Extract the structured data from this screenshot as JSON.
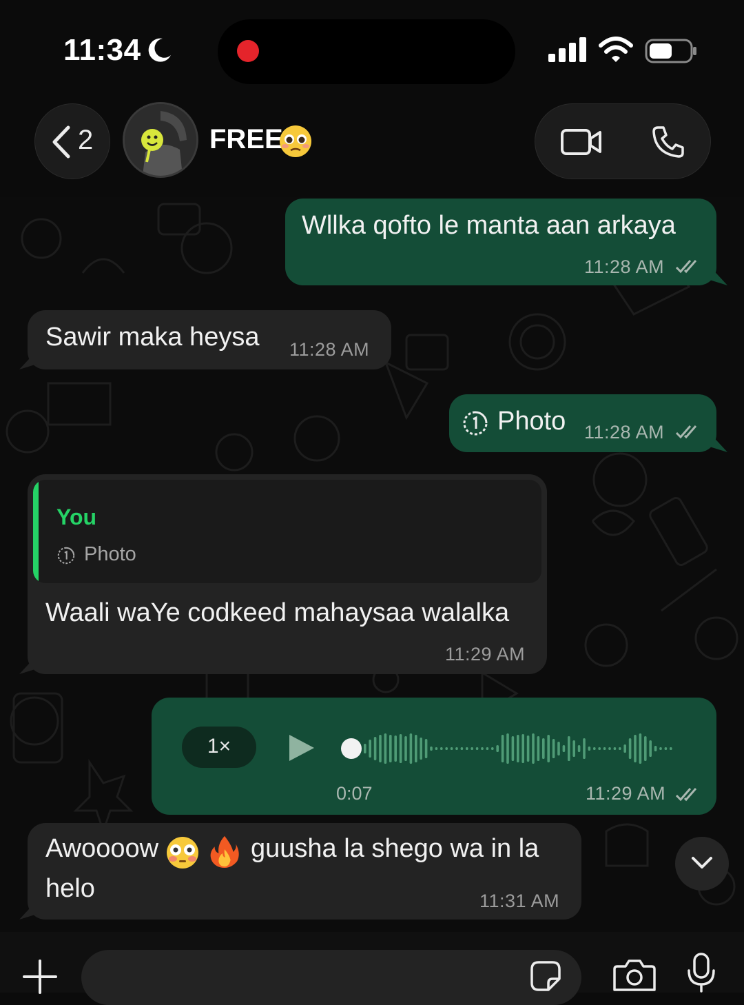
{
  "status_bar": {
    "time": "11:34",
    "icons": [
      "moon-icon",
      "recording-dot",
      "cellular-signal-icon",
      "wifi-icon",
      "battery-icon"
    ]
  },
  "header": {
    "back_count": "2",
    "contact_name": "FREE",
    "name_emoji": "pleading-face-emoji",
    "actions": [
      "video-call-icon",
      "voice-call-icon"
    ]
  },
  "messages": [
    {
      "direction": "outgoing",
      "text": "Wllka qofto le manta aan arkaya",
      "time": "11:28 AM",
      "status": "read"
    },
    {
      "direction": "incoming",
      "text": "Sawir maka heysa",
      "time": "11:28 AM"
    },
    {
      "direction": "outgoing",
      "type": "view-once-photo",
      "text": "Photo",
      "time": "11:28 AM",
      "status": "read"
    },
    {
      "direction": "incoming",
      "quote": {
        "author": "You",
        "text": "Photo"
      },
      "text": "Waali waYe codkeed mahaysaa walalka",
      "time": "11:29 AM"
    },
    {
      "direction": "outgoing",
      "type": "voice-note",
      "speed": "1×",
      "duration": "0:07",
      "time": "11:29 AM",
      "status": "read"
    },
    {
      "direction": "incoming",
      "text_line1": "Awoooow",
      "text_line1_rest": "guusha la shego wa in la",
      "text_line2": "helo",
      "emojis": [
        "flushed-face-emoji",
        "fire-emoji"
      ],
      "time": "11:31 AM"
    }
  ],
  "composer": {
    "placeholder": "",
    "icons": [
      "plus-icon",
      "sticker-icon",
      "camera-icon",
      "microphone-icon"
    ]
  },
  "colors": {
    "background": "#0b0b0b",
    "outgoing_bubble": "#144d37",
    "incoming_bubble": "#232323",
    "accent_green": "#25d366",
    "read_ticks": "#a9b7b0"
  }
}
